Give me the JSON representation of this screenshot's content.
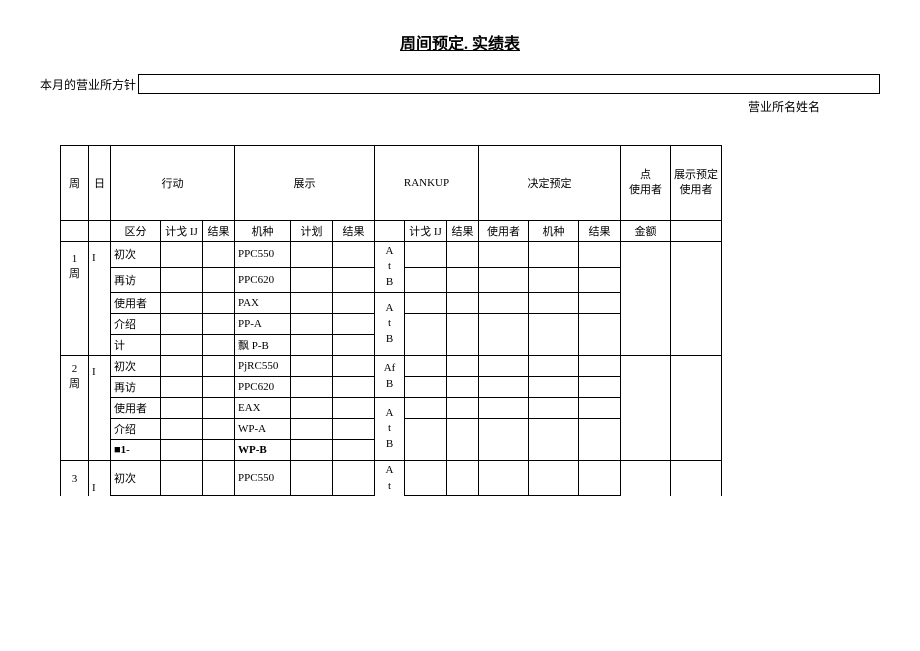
{
  "title": "周间预定. 实绩表",
  "policy_label": "本月的营业所方针",
  "office_name_label": "营业所名姓名",
  "headers": {
    "week": "周",
    "day": "日",
    "action": "行动",
    "display": "展示",
    "rankup": "RANKUP",
    "decide_predet": "决定预定",
    "point": "点",
    "user": "使用者",
    "display_predet": "展示预定",
    "display_user": "使用者",
    "kubun": "区分",
    "plan_ij": "计戈 IJ",
    "result": "结果",
    "model": "机种",
    "plan": "计划",
    "amount": "金额"
  },
  "week_label": "周",
  "rows": [
    {
      "w": "1",
      "day": "I",
      "kubun": "初次",
      "model": "PPC550"
    },
    {
      "w": "",
      "day": "",
      "kubun": "再访",
      "model": "PPC620"
    },
    {
      "w": "",
      "day": "",
      "kubun": "使用者",
      "model": "PAX"
    },
    {
      "w": "",
      "day": "",
      "kubun": "介绍",
      "model": "PP-A"
    },
    {
      "w": "",
      "day": "",
      "kubun": "计",
      "model": "飘 P-B"
    }
  ],
  "rows2": [
    {
      "w": "2",
      "day": "I",
      "kubun": "初次",
      "model": "PjRC550"
    },
    {
      "w": "",
      "day": "",
      "kubun": "再访",
      "model": "PPC620"
    },
    {
      "w": "",
      "day": "",
      "kubun": "使用者",
      "model": "EAX"
    },
    {
      "w": "",
      "day": "",
      "kubun": "介绍",
      "model": "WP-A"
    },
    {
      "w": "",
      "day": "",
      "kubun": "■1-",
      "model": "WP-B",
      "bold": true
    }
  ],
  "rows3": [
    {
      "w": "3",
      "day": "I",
      "kubun": "初次",
      "model": "PPC550"
    }
  ],
  "rank_labels": {
    "A": "A",
    "t": "t",
    "B": "B",
    "Af": "Af"
  }
}
